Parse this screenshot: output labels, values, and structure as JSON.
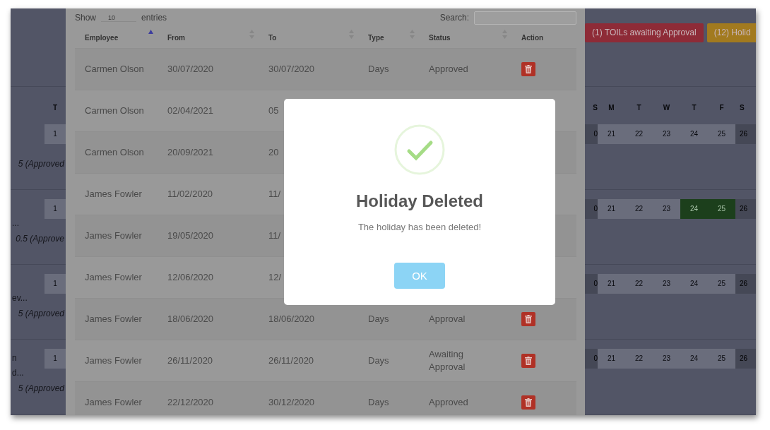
{
  "calendar": {
    "badges": [
      {
        "label": "(1) TOILs awaiting Approval",
        "color": "#8e2b37"
      },
      {
        "label": "(12) Holid",
        "color": "#a27a1f"
      }
    ],
    "left_header": "T",
    "weekdays": [
      "S",
      "M",
      "T",
      "W",
      "T",
      "F",
      "S"
    ],
    "weeks": [
      {
        "left_day": "1",
        "note": "5 (Approved",
        "days": [
          {
            "label": "0",
            "kind": "weekend"
          },
          {
            "label": "21",
            "kind": "weekday"
          },
          {
            "label": "22",
            "kind": "weekday"
          },
          {
            "label": "23",
            "kind": "weekday"
          },
          {
            "label": "24",
            "kind": "weekday"
          },
          {
            "label": "25",
            "kind": "weekday"
          },
          {
            "label": "26",
            "kind": "weekend"
          }
        ]
      },
      {
        "label_lines": [
          "..."
        ],
        "left_day": "1",
        "note": "0.5 (Approve",
        "days": [
          {
            "label": "0",
            "kind": "weekend"
          },
          {
            "label": "21",
            "kind": "weekday"
          },
          {
            "label": "22",
            "kind": "weekday"
          },
          {
            "label": "23",
            "kind": "weekday"
          },
          {
            "label": "24",
            "kind": "holiday"
          },
          {
            "label": "25",
            "kind": "holiday"
          },
          {
            "label": "26",
            "kind": "weekend"
          }
        ]
      },
      {
        "label_lines": [
          "ev..."
        ],
        "left_day": "1",
        "note": "5 (Approved",
        "days": [
          {
            "label": "0",
            "kind": "weekend"
          },
          {
            "label": "21",
            "kind": "weekday"
          },
          {
            "label": "22",
            "kind": "weekday"
          },
          {
            "label": "23",
            "kind": "weekday"
          },
          {
            "label": "24",
            "kind": "weekday"
          },
          {
            "label": "25",
            "kind": "weekday"
          },
          {
            "label": "26",
            "kind": "weekend"
          }
        ]
      },
      {
        "label_lines": [
          "n",
          "d..."
        ],
        "left_day": "1",
        "note": "5 (Approved",
        "days": [
          {
            "label": "0",
            "kind": "weekend"
          },
          {
            "label": "21",
            "kind": "weekday"
          },
          {
            "label": "22",
            "kind": "weekday"
          },
          {
            "label": "23",
            "kind": "weekday"
          },
          {
            "label": "24",
            "kind": "weekday"
          },
          {
            "label": "25",
            "kind": "weekday"
          },
          {
            "label": "26",
            "kind": "weekend"
          }
        ]
      }
    ]
  },
  "modal": {
    "show_label": "Show",
    "length_value": "10",
    "entries_label": "entries",
    "search_label": "Search:",
    "columns": [
      {
        "label": "Employee",
        "sortable": true,
        "sorted": true
      },
      {
        "label": "From",
        "sortable": true,
        "sorted": false
      },
      {
        "label": "To",
        "sortable": true,
        "sorted": false
      },
      {
        "label": "Type",
        "sortable": true,
        "sorted": false
      },
      {
        "label": "Status",
        "sortable": true,
        "sorted": false
      },
      {
        "label": "Action",
        "sortable": false
      }
    ],
    "rows": [
      {
        "cells": [
          "Carmen Olson",
          "30/07/2020",
          "30/07/2020",
          "Days",
          "Approved"
        ],
        "delete": true
      },
      {
        "cells": [
          "Carmen Olson",
          "02/04/2021",
          "05"
        ]
      },
      {
        "cells": [
          "Carmen Olson",
          "20/09/2021",
          "20"
        ]
      },
      {
        "cells": [
          "James Fowler",
          "11/02/2020",
          "11/"
        ]
      },
      {
        "cells": [
          "James Fowler",
          "19/05/2020",
          "11/"
        ]
      },
      {
        "cells": [
          "James Fowler",
          "12/06/2020",
          "12/"
        ]
      },
      {
        "cells": [
          "James Fowler",
          "18/06/2020",
          "18/06/2020",
          "Days",
          "Approval"
        ],
        "delete": true
      },
      {
        "cells": [
          "James Fowler",
          "26/11/2020",
          "26/11/2020",
          "Days",
          "Awaiting Approval"
        ],
        "delete": true
      },
      {
        "cells": [
          "James Fowler",
          "22/12/2020",
          "30/12/2020",
          "Days",
          "Approved"
        ],
        "delete": true
      }
    ]
  },
  "alert": {
    "title": "Holiday Deleted",
    "text": "The holiday has been deleted!",
    "button": "OK"
  }
}
